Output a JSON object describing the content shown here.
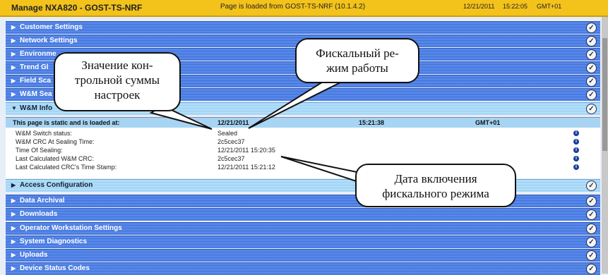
{
  "header": {
    "title": "Manage NXA820 - GOST-TS-NRF",
    "status": "Page is loaded from GOST-TS-NRF (10.1.4.2)",
    "date": "12/21/2011",
    "time": "15:22:05",
    "timezone": "GMT+01"
  },
  "sections_top": [
    {
      "label": "Customer Settings"
    },
    {
      "label": "Network Settings"
    },
    {
      "label": "Environme"
    },
    {
      "label": "Trend Gl"
    },
    {
      "label": "Field Sca"
    },
    {
      "label": "W&M Sea"
    },
    {
      "label": "W&M Info"
    }
  ],
  "panel": {
    "static_note": "This page is static and is loaded at:",
    "loaded_date": "12/21/2011",
    "loaded_time": "15:21:38",
    "loaded_tz": "GMT+01",
    "rows": [
      {
        "key": "W&M Switch status:",
        "value": "Sealed"
      },
      {
        "key": "W&M CRC At Sealing Time:",
        "value": "2c5cec37"
      },
      {
        "key": "Time Of Sealing:",
        "value": "12/21/2011 15:20:35"
      },
      {
        "key": "Last Calculated W&M CRC:",
        "value": "2c5cec37"
      },
      {
        "key": "Last Calculated CRC's Time Stamp:",
        "value": "12/21/2011 15:21:12"
      }
    ]
  },
  "sections_bottom": [
    {
      "label": "Access Configuration"
    },
    {
      "label": "Data Archival"
    },
    {
      "label": "Downloads"
    },
    {
      "label": "Operator Workstation Settings"
    },
    {
      "label": "System Diagnostics"
    },
    {
      "label": "Uploads"
    },
    {
      "label": "Device Status Codes"
    }
  ],
  "callouts": {
    "checksum": "Значение кон-\nтрольной суммы\nнастроек",
    "fiscal_mode": "Фискальный ре-\nжим работы",
    "fiscal_date": "Дата включения\nфискального режима"
  },
  "icons": {
    "check": "check-circle-icon",
    "info": "info-icon",
    "arrow": "triangle-right-icon"
  },
  "colors": {
    "header": "#f3c21b",
    "row": "#4e7fe0",
    "row_light": "#a8d8f6"
  }
}
